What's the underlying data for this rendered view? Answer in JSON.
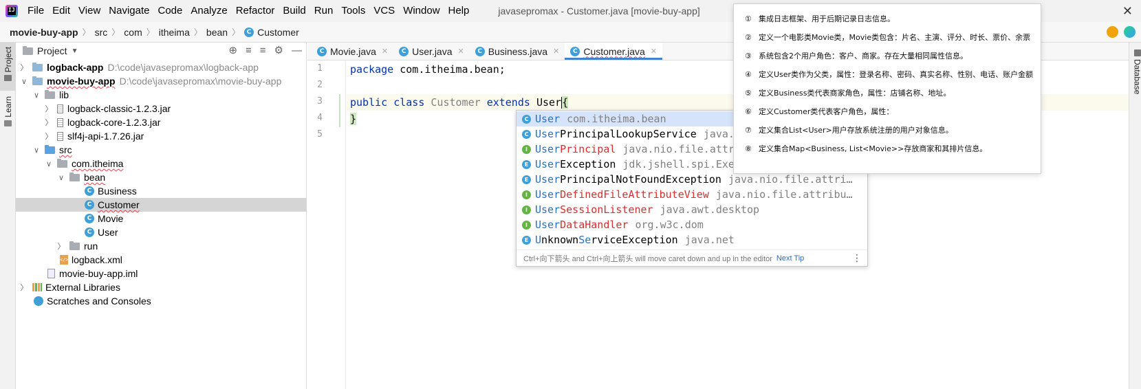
{
  "menubar": {
    "logo_text": "IJ",
    "items": [
      "File",
      "Edit",
      "View",
      "Navigate",
      "Code",
      "Analyze",
      "Refactor",
      "Build",
      "Run",
      "Tools",
      "VCS",
      "Window",
      "Help"
    ],
    "window_title": "javasepromax - Customer.java [movie-buy-app]",
    "close_glyph": "✕"
  },
  "breadcrumb": {
    "items": [
      "movie-buy-app",
      "src",
      "com",
      "itheima",
      "bean",
      "Customer"
    ],
    "separator": "〉",
    "class_badge": "C"
  },
  "left_strip": {
    "tabs": [
      "Project",
      "Learn"
    ]
  },
  "right_strip": {
    "tabs": [
      "Database"
    ]
  },
  "project_panel": {
    "title": "Project",
    "dropdown_glyph": "▼",
    "header_icons": [
      "⊕",
      "≡",
      "≡",
      "⚙",
      "—"
    ],
    "tree": [
      {
        "label": "logback-app",
        "hint": "D:\\code\\javasepromax\\logback-app",
        "arrow": "〉"
      },
      {
        "label": "movie-buy-app",
        "hint": "D:\\code\\javasepromax\\movie-buy-app",
        "arrow": "∨"
      },
      {
        "label": "lib",
        "arrow": "∨"
      },
      {
        "label": "logback-classic-1.2.3.jar",
        "arrow": "〉"
      },
      {
        "label": "logback-core-1.2.3.jar",
        "arrow": "〉"
      },
      {
        "label": "slf4j-api-1.7.26.jar",
        "arrow": "〉"
      },
      {
        "label": "src",
        "arrow": "∨"
      },
      {
        "label": "com.itheima",
        "arrow": "∨"
      },
      {
        "label": "bean",
        "arrow": "∨"
      },
      {
        "label": "Business"
      },
      {
        "label": "Customer"
      },
      {
        "label": "Movie"
      },
      {
        "label": "User"
      },
      {
        "label": "run",
        "arrow": "〉"
      },
      {
        "label": "logback.xml"
      },
      {
        "label": "movie-buy-app.iml"
      },
      {
        "label": "External Libraries",
        "arrow": "〉"
      },
      {
        "label": "Scratches and Consoles"
      }
    ]
  },
  "editor_tabs": [
    {
      "label": "Movie.java",
      "close": "✕"
    },
    {
      "label": "User.java",
      "close": "✕"
    },
    {
      "label": "Business.java",
      "close": "✕"
    },
    {
      "label": "Customer.java",
      "close": "✕"
    }
  ],
  "editor": {
    "line_numbers": [
      "1",
      "2",
      "3",
      "4",
      "5"
    ],
    "line1": {
      "kw": "package",
      "rest": " com.itheima.bean;"
    },
    "line3": {
      "kw1": "public",
      "kw2": "class",
      "name": "Customer",
      "kw3": "extends",
      "typed": "User",
      "brace": "{"
    },
    "line4": "}"
  },
  "completion": {
    "items": [
      {
        "kind": "C",
        "match": "User",
        "rest": "",
        "pkg": "com.itheima.bean"
      },
      {
        "kind": "C",
        "match": "User",
        "rest": "PrincipalLookupService",
        "pkg": "java."
      },
      {
        "kind": "I",
        "match": "User",
        "rest": "Principal",
        "pkg": "java.nio.file.attr"
      },
      {
        "kind": "E",
        "match": "User",
        "rest": "Exception",
        "pkg": "jdk.jshell.spi.Exe"
      },
      {
        "kind": "E",
        "match": "User",
        "rest": "PrincipalNotFoundException",
        "pkg": "java.nio.file.attri…"
      },
      {
        "kind": "I",
        "match": "User",
        "rest": "DefinedFileAttributeView",
        "pkg": "java.nio.file.attribu…"
      },
      {
        "kind": "I",
        "match": "User",
        "rest": "SessionListener",
        "pkg": "java.awt.desktop"
      },
      {
        "kind": "I",
        "match": "User",
        "rest": "DataHandler",
        "pkg": "org.w3c.dom"
      },
      {
        "kind": "E",
        "match": "U",
        "rest": "nknown",
        "match2": "Se",
        "rest2": "rviceException",
        "pkg": "java.net"
      }
    ],
    "footer": "Ctrl+向下箭头 and Ctrl+向上箭头 will move caret down and up in the editor",
    "next_tip": "Next Tip",
    "more": "⋮"
  },
  "notes": [
    {
      "num": "①",
      "text": "集成日志框架、用于后期记录日志信息。"
    },
    {
      "num": "②",
      "text": "定义一个电影类Movie类，Movie类包含：片名、主演、评分、时长、票价、余票"
    },
    {
      "num": "③",
      "text": "系统包含2个用户角色：客户、商家。存在大量相同属性信息。"
    },
    {
      "num": "④",
      "text": "定义User类作为父类，属性：登录名称、密码、真实名称、性别、电话、账户金额"
    },
    {
      "num": "⑤",
      "text": "定义Business类代表商家角色，属性：店铺名称、地址。"
    },
    {
      "num": "⑥",
      "text": "定义Customer类代表客户角色，属性："
    },
    {
      "num": "⑦",
      "text": "定义集合List<User>用户存放系统注册的用户对象信息。"
    },
    {
      "num": "⑧",
      "text": "定义集合Map<Business, List<Movie>>存放商家和其排片信息。"
    }
  ],
  "colors": {
    "keyword": "#0033b3",
    "match": "#2471cf",
    "interface": "#d62f2f",
    "selection": "#d5d5d5",
    "tab_underline": "#4083c9"
  }
}
